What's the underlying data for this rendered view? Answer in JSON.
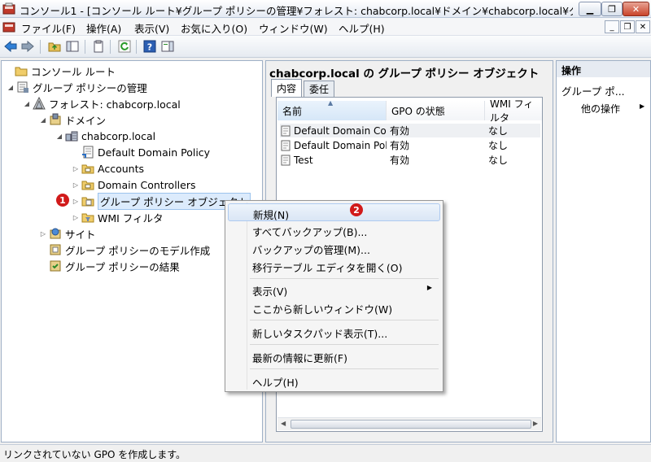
{
  "window": {
    "title": "コンソール1 - [コンソール ルート¥グループ ポリシーの管理¥フォレスト: chabcorp.local¥ドメイン¥chabcorp.local¥グル...",
    "min_glyph": "▁",
    "max_glyph": "❐",
    "close_glyph": "✕"
  },
  "menubar": {
    "items": [
      "ファイル(F)",
      "操作(A)",
      "表示(V)",
      "お気に入り(O)",
      "ウィンドウ(W)",
      "ヘルプ(H)"
    ],
    "mdi_min": "_",
    "mdi_restore": "❐",
    "mdi_close": "✕"
  },
  "tree": {
    "items": [
      {
        "label": "コンソール ルート",
        "expander": ""
      },
      {
        "label": "グループ ポリシーの管理",
        "expander": "◢"
      },
      {
        "label": "フォレスト: chabcorp.local",
        "expander": "◢"
      },
      {
        "label": "ドメイン",
        "expander": "◢"
      },
      {
        "label": "chabcorp.local",
        "expander": "◢"
      },
      {
        "label": "Default Domain Policy",
        "expander": ""
      },
      {
        "label": "Accounts",
        "expander": "▷"
      },
      {
        "label": "Domain Controllers",
        "expander": "▷"
      },
      {
        "label": "グループ ポリシー オブジェクト",
        "expander": "▷"
      },
      {
        "label": "WMI フィルタ",
        "expander": "▷"
      },
      {
        "label": "サイト",
        "expander": "▷"
      },
      {
        "label": "グループ ポリシーのモデル作成",
        "expander": ""
      },
      {
        "label": "グループ ポリシーの結果",
        "expander": ""
      }
    ]
  },
  "center": {
    "title": "chabcorp.local の グループ ポリシー オブジェクト",
    "tabs": [
      "内容",
      "委任"
    ],
    "columns": [
      "名前",
      "GPO の状態",
      "WMI フィルタ"
    ],
    "rows": [
      {
        "name": "Default Domain Con...",
        "state": "有効",
        "wmi": "なし"
      },
      {
        "name": "Default Domain Poli...",
        "state": "有効",
        "wmi": "なし"
      },
      {
        "name": "Test",
        "state": "有効",
        "wmi": "なし"
      }
    ]
  },
  "actions": {
    "header": "操作",
    "section": "グループ ポ...",
    "other": "他の操作"
  },
  "context_menu": {
    "new": "新規(N)",
    "backup_all": "すべてバックアップ(B)...",
    "manage_backups": "バックアップの管理(M)...",
    "migration_table": "移行テーブル エディタを開く(O)",
    "view": "表示(V)",
    "new_window": "ここから新しいウィンドウ(W)",
    "new_taskpad": "新しいタスクパッド表示(T)...",
    "refresh": "最新の情報に更新(F)",
    "help": "ヘルプ(H)"
  },
  "markers": {
    "one": "1",
    "two": "2"
  },
  "status": "リンクされていない GPO を作成します。",
  "colors": {
    "marker": "#d11a1a",
    "highlight": "#dae6f5"
  }
}
